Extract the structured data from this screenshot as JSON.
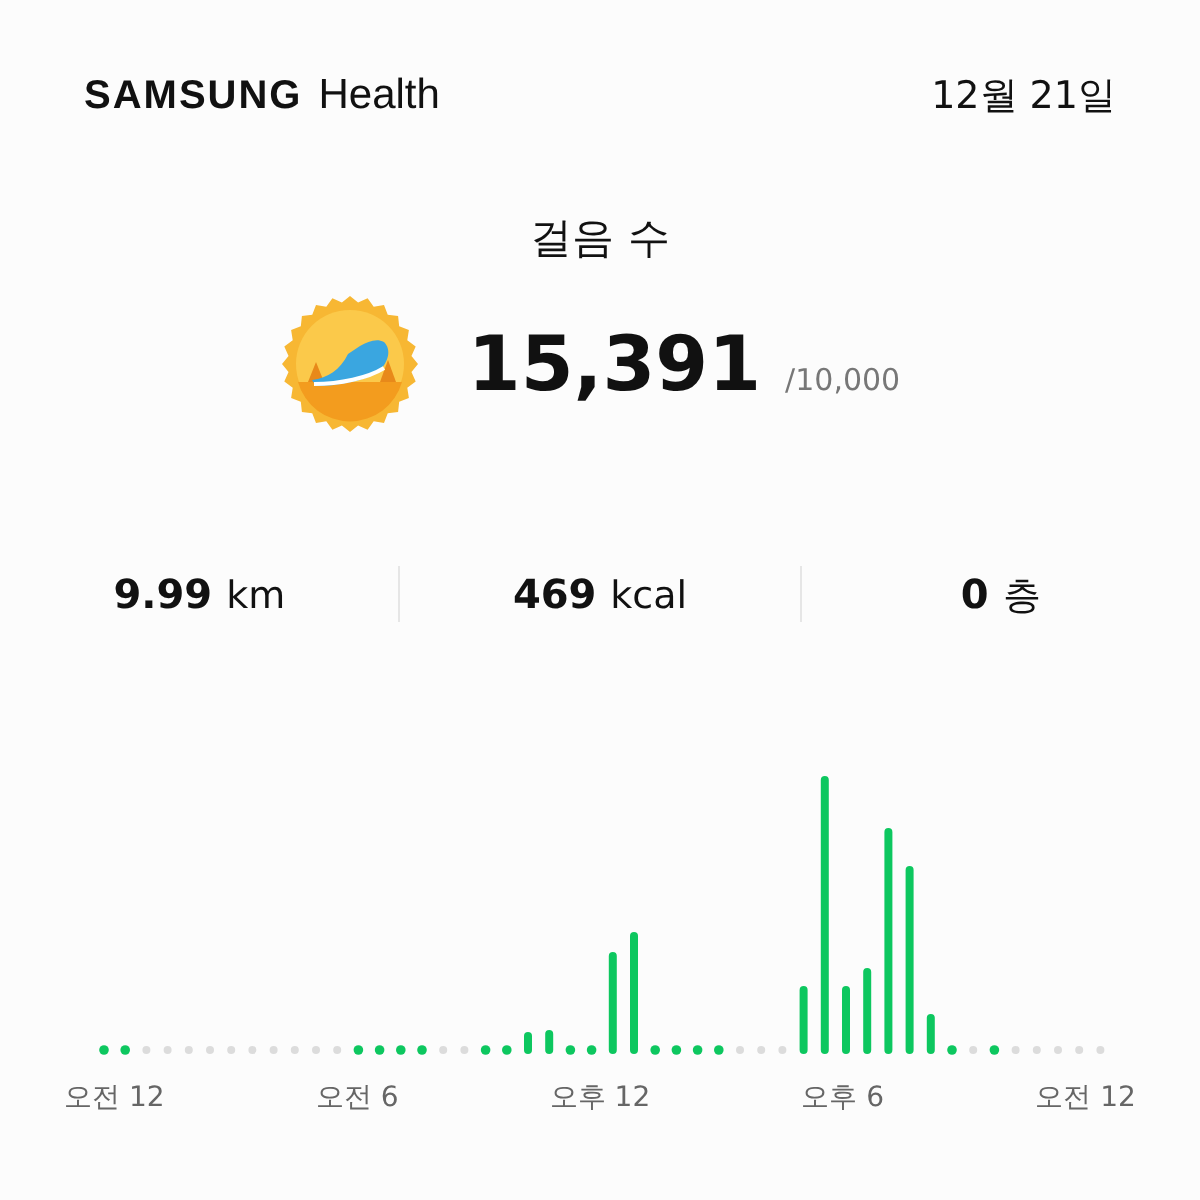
{
  "header": {
    "brand": "SAMSUNG",
    "app": "Health",
    "date": "12월 21일"
  },
  "steps": {
    "title": "걸음 수",
    "count": "15,391",
    "goal": "/10,000"
  },
  "stats": [
    {
      "value": "9.99",
      "unit": "km"
    },
    {
      "value": "469",
      "unit": "kcal"
    },
    {
      "value": "0",
      "unit": "층"
    }
  ],
  "chart": {
    "x_labels": [
      "오전 12",
      "오전 6",
      "오후 12",
      "오후 6",
      "오전 12"
    ]
  }
}
